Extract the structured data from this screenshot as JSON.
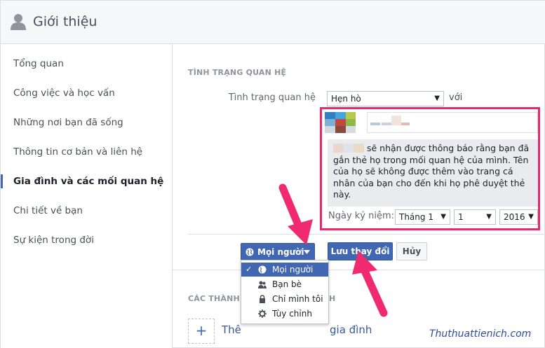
{
  "header": {
    "title": "Giới thiệu",
    "icon": "person-icon"
  },
  "sidebar": {
    "items": [
      {
        "label": "Tổng quan"
      },
      {
        "label": "Công việc và học vấn"
      },
      {
        "label": "Những nơi bạn đã sống"
      },
      {
        "label": "Thông tin cơ bản và liên hệ"
      },
      {
        "label": "Gia đình và các mối quan hệ"
      },
      {
        "label": "Chi tiết về bạn"
      },
      {
        "label": "Sự kiện trong đời"
      }
    ],
    "active_index": 4
  },
  "relationship": {
    "section_title": "TÌNH TRẠNG QUAN HỆ",
    "field_label": "Tình trạng quan hệ",
    "status_value": "Hẹn hò",
    "with_label": "với",
    "notice": "sẽ nhận được thông báo rằng bạn đã gắn thẻ họ trong mối quan hệ của mình. Tên của họ sẽ không được thêm vào trang cá nhân của bạn cho đến khi họ phê duyệt thẻ này.",
    "anniversary_label": "Ngày kỷ niệm:",
    "month_value": "Tháng 1",
    "day_value": "1",
    "year_value": "2016"
  },
  "actions": {
    "privacy_label": "Mọi người",
    "save_label": "Lưu thay đổi",
    "cancel_label": "Hủy"
  },
  "privacy_menu": {
    "items": [
      {
        "label": "Mọi người",
        "icon": "globe-icon",
        "selected": true
      },
      {
        "label": "Bạn bè",
        "icon": "friends-icon",
        "selected": false
      },
      {
        "label": "Chỉ mình tôi",
        "icon": "lock-icon",
        "selected": false
      },
      {
        "label": "Tùy chỉnh",
        "icon": "gear-icon",
        "selected": false
      }
    ],
    "check_mark": "✓"
  },
  "family": {
    "section_title_start": "CÁC THÀNH",
    "section_title_end": "H",
    "add_text_start": "Thê",
    "add_text_end": "gia đình",
    "add_symbol": "+"
  },
  "watermark": "Thuthuattienich.com",
  "colors": {
    "accent": "#4267b2",
    "highlight": "#e8296c"
  }
}
